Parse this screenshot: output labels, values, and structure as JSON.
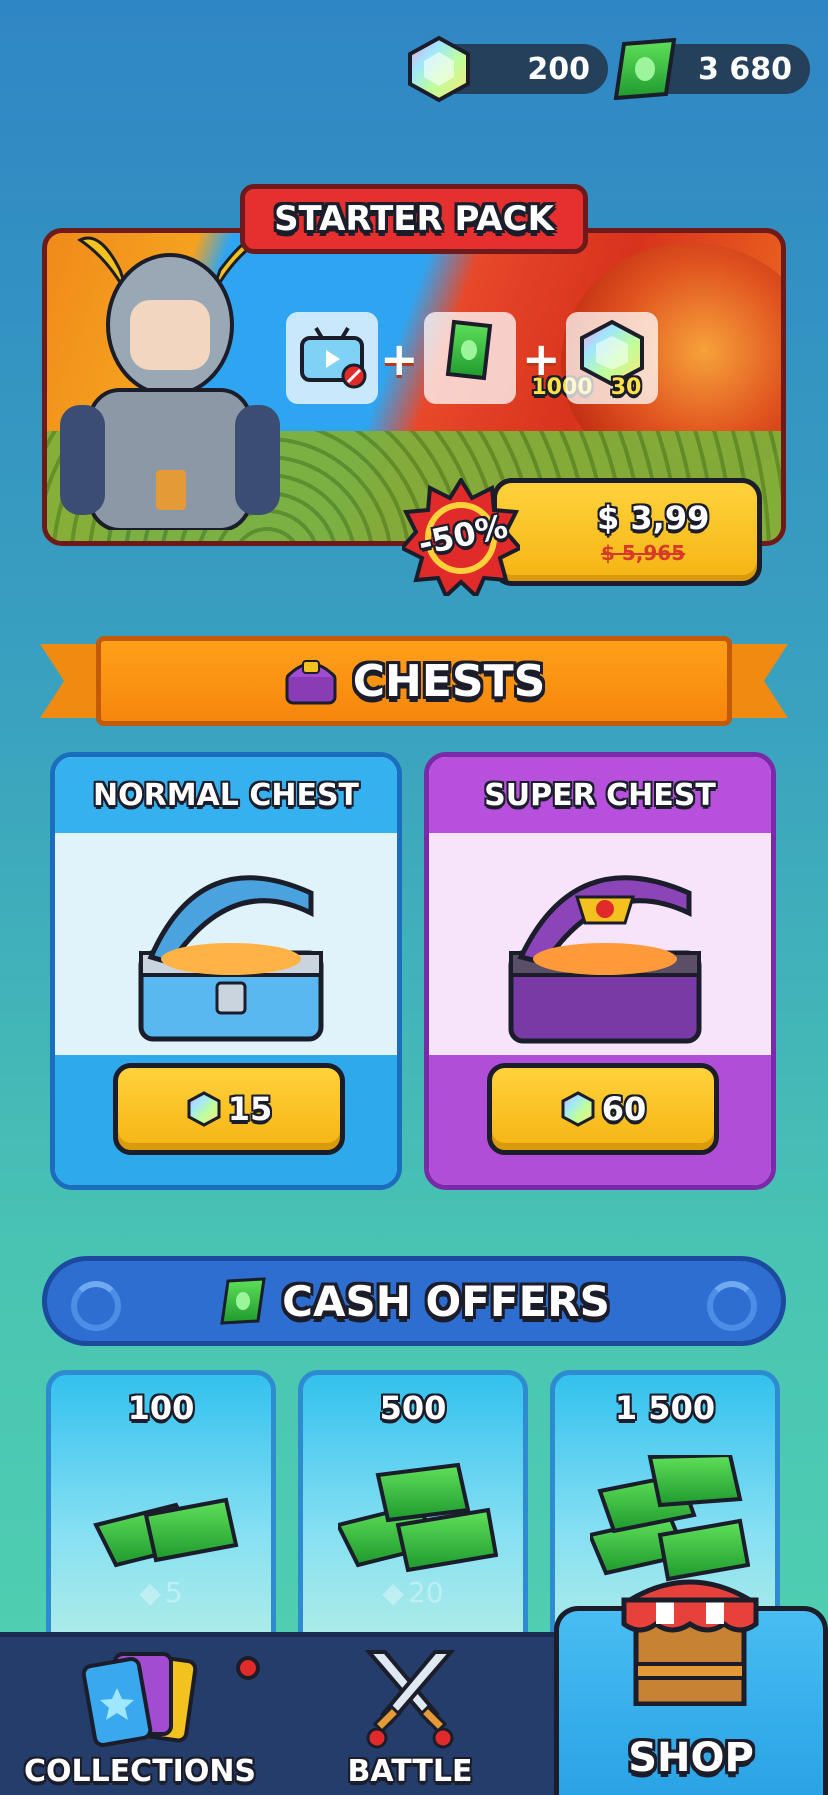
{
  "currency": {
    "gems": "200",
    "cash": "3 680"
  },
  "starter_pack": {
    "title": "STARTER PACK",
    "rewards": {
      "cash": "1000",
      "gems": "30"
    },
    "discount": "-50%",
    "price": "$ 3,99",
    "old_price": "$ 5,965"
  },
  "chests": {
    "title": "CHESTS",
    "normal": {
      "title": "NORMAL CHEST",
      "price": "15"
    },
    "super": {
      "title": "SUPER CHEST",
      "price": "60"
    }
  },
  "cash_offers": {
    "title": "CASH OFFERS",
    "items": [
      {
        "amount": "100",
        "price": "5"
      },
      {
        "amount": "500",
        "price": "20"
      },
      {
        "amount": "1 500",
        "price": ""
      }
    ]
  },
  "nav": {
    "collections": "COLLECTIONS",
    "battle": "BATTLE",
    "shop": "SHOP"
  },
  "colors": {
    "gold_button": "#f5b414",
    "normal_chest": "#34b1ee",
    "super_chest": "#b750dc",
    "nav_bg": "#243d6a"
  }
}
